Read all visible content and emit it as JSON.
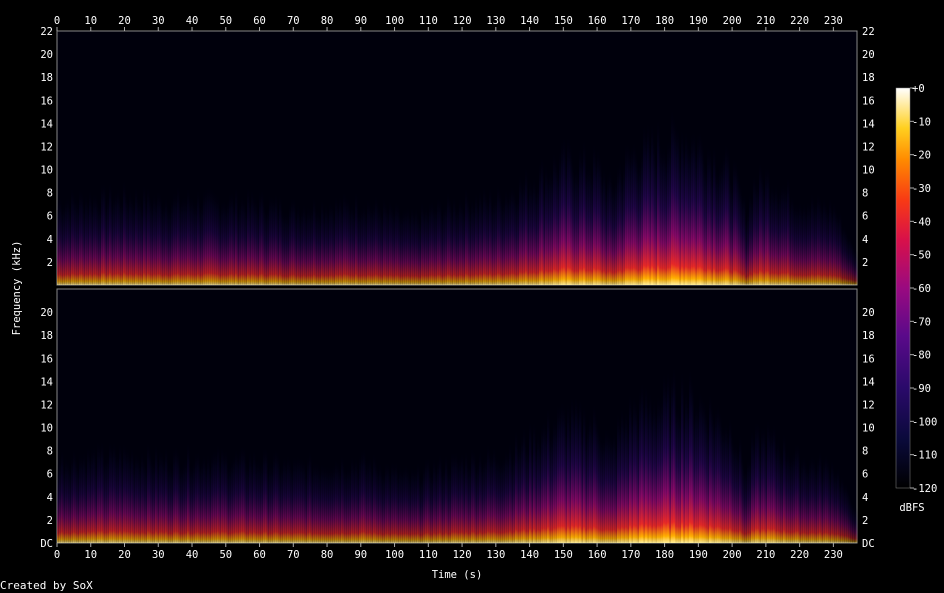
{
  "chart_data": {
    "type": "heatmap",
    "title": "",
    "xlabel": "Time (s)",
    "ylabel": "Frequency (kHz)",
    "xlim": [
      0,
      237
    ],
    "ylim": [
      0,
      22
    ],
    "x_ticks": [
      "0",
      "10",
      "20",
      "30",
      "40",
      "50",
      "60",
      "70",
      "80",
      "90",
      "100",
      "110",
      "120",
      "130",
      "140",
      "150",
      "160",
      "170",
      "180",
      "190",
      "200",
      "210",
      "220",
      "230"
    ],
    "y_ticks_top": [
      "2",
      "4",
      "6",
      "8",
      "10",
      "12",
      "14",
      "16",
      "18",
      "20",
      "22"
    ],
    "y_ticks_bottom": [
      "DC",
      "2",
      "4",
      "6",
      "8",
      "10",
      "12",
      "14",
      "16",
      "18",
      "20"
    ],
    "colorbar": {
      "label": "dBFS",
      "ticks": [
        "+0",
        "-10",
        "-20",
        "-30",
        "-40",
        "-50",
        "-60",
        "-70",
        "-80",
        "-90",
        "-100",
        "-110",
        "-120"
      ],
      "range": [
        -120,
        0
      ]
    },
    "channels": 2,
    "energy_envelope": {
      "x": [
        0,
        10,
        20,
        30,
        40,
        50,
        60,
        70,
        80,
        90,
        100,
        105,
        110,
        120,
        130,
        140,
        150,
        160,
        164,
        166,
        170,
        180,
        185,
        190,
        200,
        204,
        206,
        210,
        220,
        230,
        237
      ],
      "level": [
        0.45,
        0.48,
        0.5,
        0.46,
        0.47,
        0.46,
        0.45,
        0.4,
        0.42,
        0.44,
        0.36,
        0.32,
        0.38,
        0.45,
        0.48,
        0.62,
        0.8,
        0.75,
        0.55,
        0.7,
        0.85,
        0.95,
        1.0,
        0.92,
        0.7,
        0.35,
        0.6,
        0.65,
        0.45,
        0.4,
        0.0
      ]
    }
  },
  "footer": {
    "credit": "Created by SoX"
  }
}
